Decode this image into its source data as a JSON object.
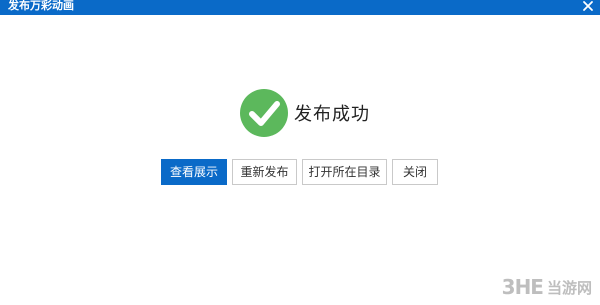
{
  "window": {
    "title": "发布万彩动画",
    "close_icon": "close-icon"
  },
  "status": {
    "icon": "checkmark-circle-icon",
    "icon_color": "#5cb85c",
    "message": "发布成功"
  },
  "actions": {
    "view_label": "查看展示",
    "republish_label": "重新发布",
    "open_folder_label": "打开所在目录",
    "close_label": "关闭"
  },
  "watermark": {
    "logo": "3HE",
    "text": "当游网"
  },
  "colors": {
    "accent": "#0a6ac8",
    "success": "#5cb85c"
  }
}
